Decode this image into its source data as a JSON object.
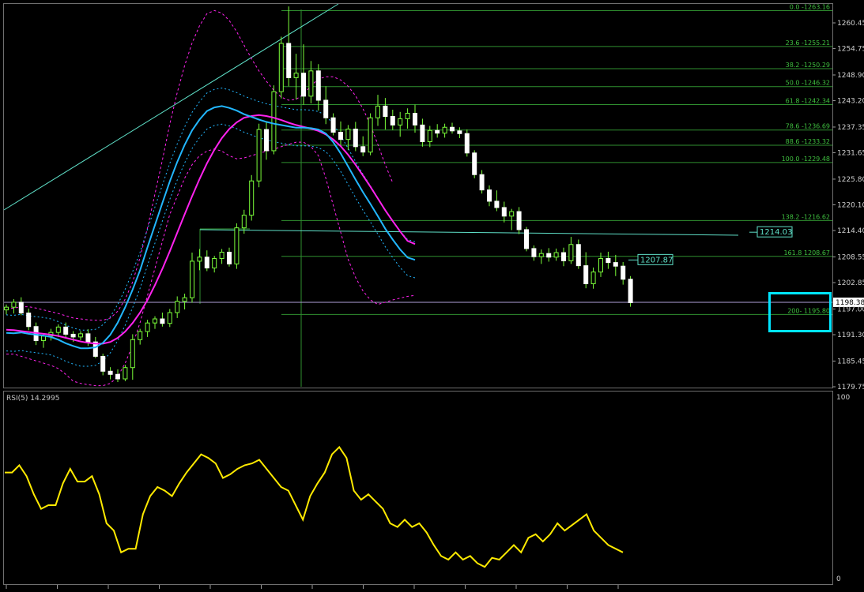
{
  "chart_data": [
    {
      "type": "candlestick",
      "ylim": [
        1179.75,
        1266.2
      ],
      "y_ticks": [
        "1260.45",
        "1254.75",
        "1248.90",
        "1243.20",
        "1237.35",
        "1231.65",
        "1225.80",
        "1220.10",
        "1214.40",
        "1208.55",
        "1202.85",
        "1197.00",
        "1191.30",
        "1185.45",
        "1179.75"
      ],
      "current_price": "1198.38",
      "fibonacci_levels": [
        {
          "label": "0.0 -1263.16",
          "value": 1263.16
        },
        {
          "label": "23.6 -1255.21",
          "value": 1255.21
        },
        {
          "label": "38.2 -1250.29",
          "value": 1250.29
        },
        {
          "label": "50.0 -1246.32",
          "value": 1246.32
        },
        {
          "label": "61.8 -1242.34",
          "value": 1242.34
        },
        {
          "label": "78.6 -1236.69",
          "value": 1236.69
        },
        {
          "label": "88.6 -1233.32",
          "value": 1233.32
        },
        {
          "label": "100.0 -1229.48",
          "value": 1229.48
        },
        {
          "label": "138.2 -1216.62",
          "value": 1216.62
        },
        {
          "label": "161.8 1208.67",
          "value": 1208.67
        },
        {
          "label": "200- 1195.80",
          "value": 1195.8
        }
      ],
      "price_tags": [
        {
          "label": "1214.03",
          "value": 1214.03
        },
        {
          "label": "1207.87",
          "value": 1207.87
        }
      ],
      "series": [
        {
          "type": "line",
          "color": "#22b7ff",
          "values": [
            1191.7,
            1191.6,
            1191.8,
            1191.5,
            1191.3,
            1191.1,
            1190.8,
            1190.2,
            1189.4,
            1188.8,
            1188.3,
            1188.3,
            1188.5,
            1189.5,
            1191.3,
            1194.0,
            1197.4,
            1201.3,
            1205.6,
            1210.7,
            1215.6,
            1220.5,
            1225.3,
            1229.6,
            1233.4,
            1236.6,
            1239.0,
            1240.9,
            1241.7,
            1242.0,
            1241.6,
            1241.0,
            1240.2,
            1239.6,
            1239.0,
            1238.5,
            1238.1,
            1237.8,
            1237.5,
            1237.2,
            1237.2,
            1237.1,
            1236.8,
            1235.9,
            1234.0,
            1231.5,
            1228.6,
            1225.7,
            1222.9,
            1220.3,
            1217.6,
            1214.8,
            1212.4,
            1210.2,
            1208.4,
            1207.9
          ]
        },
        {
          "type": "line",
          "color": "#ff22ee",
          "values": [
            1192.4,
            1192.3,
            1192.1,
            1191.9,
            1191.7,
            1191.5,
            1191.3,
            1191.0,
            1190.6,
            1190.2,
            1189.8,
            1189.5,
            1189.3,
            1189.3,
            1189.7,
            1190.6,
            1192.0,
            1193.9,
            1196.2,
            1199.0,
            1202.3,
            1205.9,
            1209.8,
            1213.9,
            1218.0,
            1222.0,
            1225.8,
            1229.3,
            1232.3,
            1234.9,
            1236.9,
            1238.4,
            1239.4,
            1239.8,
            1240.0,
            1239.8,
            1239.4,
            1238.9,
            1238.3,
            1237.8,
            1237.4,
            1237.0,
            1236.5,
            1235.7,
            1234.6,
            1233.1,
            1231.2,
            1229.0,
            1226.6,
            1224.1,
            1221.5,
            1218.9,
            1216.5,
            1214.2,
            1212.1,
            1211.4
          ]
        },
        {
          "type": "line",
          "color": "#ff22ee",
          "values": [
            1187,
            1187,
            1186.5,
            1186,
            1185.5,
            1185,
            1184.5,
            1183.8,
            1182.5,
            1181,
            1180.5,
            1180.2,
            1180,
            1180,
            1180.5,
            1182,
            1185,
            1189,
            1194,
            1200,
            1206,
            1212,
            1218,
            1222,
            1226,
            1229,
            1231,
            1232,
            1232.5,
            1232,
            1231,
            1230.3,
            1230.5,
            1231,
            1231.5,
            1232,
            1232.4,
            1233,
            1233.5,
            1234,
            1234,
            1233,
            1231,
            1226,
            1220,
            1214,
            1208,
            1204,
            1201,
            1199,
            1198,
            1198.5,
            1199,
            1199.4,
            1199.8,
            1200
          ]
        },
        {
          "type": "line",
          "color": "#ff22ee",
          "values": [
            1197,
            1197.2,
            1197.5,
            1197.5,
            1197.2,
            1196.8,
            1196.4,
            1196,
            1195.5,
            1195,
            1194.8,
            1194.6,
            1194.5,
            1194.5,
            1195,
            1196.5,
            1199.2,
            1203,
            1208.4,
            1215,
            1222.5,
            1230,
            1238,
            1245,
            1251,
            1256,
            1259.8,
            1262.5,
            1263.2,
            1262.6,
            1261,
            1258.5,
            1255.5,
            1252.5,
            1249.8,
            1247.5,
            1245.5,
            1244,
            1243.3,
            1243.5,
            1244.6,
            1246.5,
            1248,
            1248.5,
            1248.5,
            1247.8,
            1246.4,
            1244.3,
            1241.4,
            1237.8,
            1233.5,
            1229,
            1225
          ]
        }
      ],
      "candles": [
        {
          "o": 1196.8,
          "h": 1198.0,
          "l": 1195.8,
          "c": 1197.4
        },
        {
          "o": 1197.4,
          "h": 1199.2,
          "l": 1196.0,
          "c": 1198.5
        },
        {
          "o": 1198.5,
          "h": 1199.6,
          "l": 1195.6,
          "c": 1196.1
        },
        {
          "o": 1196.1,
          "h": 1197.1,
          "l": 1192.3,
          "c": 1193.1
        },
        {
          "o": 1193.1,
          "h": 1194.0,
          "l": 1189.0,
          "c": 1190.0
        },
        {
          "o": 1190.0,
          "h": 1191.6,
          "l": 1188.4,
          "c": 1191.0
        },
        {
          "o": 1191.0,
          "h": 1192.6,
          "l": 1190.0,
          "c": 1191.8
        },
        {
          "o": 1191.8,
          "h": 1193.6,
          "l": 1190.8,
          "c": 1193.0
        },
        {
          "o": 1193.0,
          "h": 1194.0,
          "l": 1190.6,
          "c": 1191.4
        },
        {
          "o": 1191.4,
          "h": 1192.1,
          "l": 1189.7,
          "c": 1190.8
        },
        {
          "o": 1190.8,
          "h": 1192.1,
          "l": 1190.1,
          "c": 1191.5
        },
        {
          "o": 1191.5,
          "h": 1192.5,
          "l": 1188.8,
          "c": 1189.7
        },
        {
          "o": 1189.7,
          "h": 1190.8,
          "l": 1186.1,
          "c": 1186.5
        },
        {
          "o": 1186.5,
          "h": 1187.1,
          "l": 1182.3,
          "c": 1183.2
        },
        {
          "o": 1183.2,
          "h": 1184.1,
          "l": 1181.4,
          "c": 1182.5
        },
        {
          "o": 1182.5,
          "h": 1183.6,
          "l": 1180.8,
          "c": 1181.5
        },
        {
          "o": 1181.5,
          "h": 1184.6,
          "l": 1181.0,
          "c": 1184.0
        },
        {
          "o": 1184.0,
          "h": 1191.4,
          "l": 1181.3,
          "c": 1190.2
        },
        {
          "o": 1190.2,
          "h": 1192.6,
          "l": 1189.1,
          "c": 1192.0
        },
        {
          "o": 1192.0,
          "h": 1194.6,
          "l": 1190.8,
          "c": 1193.9
        },
        {
          "o": 1193.9,
          "h": 1195.4,
          "l": 1192.6,
          "c": 1194.8
        },
        {
          "o": 1194.8,
          "h": 1196.2,
          "l": 1193.1,
          "c": 1193.8
        },
        {
          "o": 1193.8,
          "h": 1197.0,
          "l": 1193.0,
          "c": 1196.2
        },
        {
          "o": 1196.2,
          "h": 1199.8,
          "l": 1195.0,
          "c": 1198.7
        },
        {
          "o": 1198.7,
          "h": 1200.4,
          "l": 1196.9,
          "c": 1199.5
        },
        {
          "o": 1199.5,
          "h": 1209.5,
          "l": 1198.4,
          "c": 1207.6
        },
        {
          "o": 1207.6,
          "h": 1210.3,
          "l": 1205.6,
          "c": 1208.5
        },
        {
          "o": 1208.5,
          "h": 1210.0,
          "l": 1205.4,
          "c": 1206.1
        },
        {
          "o": 1206.1,
          "h": 1208.8,
          "l": 1205.1,
          "c": 1208.2
        },
        {
          "o": 1208.2,
          "h": 1210.3,
          "l": 1207.0,
          "c": 1209.6
        },
        {
          "o": 1209.6,
          "h": 1210.6,
          "l": 1206.4,
          "c": 1207.0
        },
        {
          "o": 1207.0,
          "h": 1216.0,
          "l": 1205.9,
          "c": 1215.0
        },
        {
          "o": 1215.0,
          "h": 1219.0,
          "l": 1213.7,
          "c": 1217.8
        },
        {
          "o": 1217.8,
          "h": 1226.7,
          "l": 1216.6,
          "c": 1225.4
        },
        {
          "o": 1225.4,
          "h": 1238.1,
          "l": 1224.0,
          "c": 1236.8
        },
        {
          "o": 1236.8,
          "h": 1238.4,
          "l": 1230.1,
          "c": 1232.1
        },
        {
          "o": 1232.1,
          "h": 1246.6,
          "l": 1231.3,
          "c": 1245.2
        },
        {
          "o": 1245.2,
          "h": 1257.4,
          "l": 1243.7,
          "c": 1255.9
        },
        {
          "o": 1255.9,
          "h": 1264.1,
          "l": 1246.4,
          "c": 1248.3
        },
        {
          "o": 1248.3,
          "h": 1253.6,
          "l": 1243.5,
          "c": 1249.3
        },
        {
          "o": 1249.3,
          "h": 1255.7,
          "l": 1242.3,
          "c": 1244.2
        },
        {
          "o": 1244.2,
          "h": 1252.0,
          "l": 1242.6,
          "c": 1249.8
        },
        {
          "o": 1249.8,
          "h": 1251.3,
          "l": 1241.0,
          "c": 1243.3
        },
        {
          "o": 1243.3,
          "h": 1246.4,
          "l": 1238.0,
          "c": 1239.4
        },
        {
          "o": 1239.4,
          "h": 1240.4,
          "l": 1235.5,
          "c": 1236.2
        },
        {
          "o": 1236.2,
          "h": 1238.6,
          "l": 1233.4,
          "c": 1234.6
        },
        {
          "o": 1234.6,
          "h": 1237.8,
          "l": 1232.3,
          "c": 1236.9
        },
        {
          "o": 1236.9,
          "h": 1238.5,
          "l": 1232.0,
          "c": 1233.0
        },
        {
          "o": 1233.0,
          "h": 1235.3,
          "l": 1230.9,
          "c": 1231.8
        },
        {
          "o": 1231.8,
          "h": 1240.4,
          "l": 1231.1,
          "c": 1239.4
        },
        {
          "o": 1239.4,
          "h": 1244.5,
          "l": 1237.6,
          "c": 1242.0
        },
        {
          "o": 1242.0,
          "h": 1243.8,
          "l": 1236.8,
          "c": 1239.7
        },
        {
          "o": 1239.7,
          "h": 1241.2,
          "l": 1236.7,
          "c": 1237.8
        },
        {
          "o": 1237.8,
          "h": 1240.7,
          "l": 1235.2,
          "c": 1239.2
        },
        {
          "o": 1239.2,
          "h": 1241.5,
          "l": 1237.0,
          "c": 1240.4
        },
        {
          "o": 1240.4,
          "h": 1242.3,
          "l": 1236.1,
          "c": 1237.8
        },
        {
          "o": 1237.8,
          "h": 1239.2,
          "l": 1233.0,
          "c": 1234.1
        },
        {
          "o": 1234.1,
          "h": 1237.6,
          "l": 1232.9,
          "c": 1236.6
        },
        {
          "o": 1236.6,
          "h": 1238.0,
          "l": 1235.0,
          "c": 1236.0
        },
        {
          "o": 1236.0,
          "h": 1238.1,
          "l": 1235.0,
          "c": 1237.3
        },
        {
          "o": 1237.3,
          "h": 1238.3,
          "l": 1235.9,
          "c": 1236.5
        },
        {
          "o": 1236.5,
          "h": 1237.3,
          "l": 1234.9,
          "c": 1235.9
        },
        {
          "o": 1235.9,
          "h": 1236.8,
          "l": 1230.8,
          "c": 1231.6
        },
        {
          "o": 1231.6,
          "h": 1232.2,
          "l": 1226.0,
          "c": 1226.8
        },
        {
          "o": 1226.8,
          "h": 1227.8,
          "l": 1222.6,
          "c": 1223.4
        },
        {
          "o": 1223.4,
          "h": 1224.4,
          "l": 1219.8,
          "c": 1220.9
        },
        {
          "o": 1220.9,
          "h": 1223.3,
          "l": 1218.7,
          "c": 1219.5
        },
        {
          "o": 1219.5,
          "h": 1220.8,
          "l": 1216.2,
          "c": 1217.6
        },
        {
          "o": 1217.6,
          "h": 1219.2,
          "l": 1214.5,
          "c": 1218.6
        },
        {
          "o": 1218.6,
          "h": 1219.6,
          "l": 1213.6,
          "c": 1214.6
        },
        {
          "o": 1214.6,
          "h": 1215.2,
          "l": 1209.8,
          "c": 1210.4
        },
        {
          "o": 1210.4,
          "h": 1211.1,
          "l": 1207.7,
          "c": 1208.6
        },
        {
          "o": 1208.6,
          "h": 1210.2,
          "l": 1207.0,
          "c": 1209.3
        },
        {
          "o": 1209.3,
          "h": 1210.5,
          "l": 1207.5,
          "c": 1208.5
        },
        {
          "o": 1208.5,
          "h": 1210.4,
          "l": 1207.7,
          "c": 1209.5
        },
        {
          "o": 1209.5,
          "h": 1210.6,
          "l": 1206.5,
          "c": 1207.7
        },
        {
          "o": 1207.7,
          "h": 1213.0,
          "l": 1207.0,
          "c": 1211.3
        },
        {
          "o": 1211.3,
          "h": 1212.4,
          "l": 1205.9,
          "c": 1206.6
        },
        {
          "o": 1206.6,
          "h": 1209.6,
          "l": 1201.6,
          "c": 1202.6
        },
        {
          "o": 1202.6,
          "h": 1206.2,
          "l": 1201.5,
          "c": 1205.2
        },
        {
          "o": 1205.2,
          "h": 1209.5,
          "l": 1204.1,
          "c": 1208.2
        },
        {
          "o": 1208.2,
          "h": 1209.7,
          "l": 1205.9,
          "c": 1207.3
        },
        {
          "o": 1207.3,
          "h": 1209.0,
          "l": 1204.3,
          "c": 1206.5
        },
        {
          "o": 1206.5,
          "h": 1207.4,
          "l": 1202.4,
          "c": 1203.6
        },
        {
          "o": 1203.6,
          "h": 1204.3,
          "l": 1197.5,
          "c": 1198.4
        }
      ]
    },
    {
      "type": "line",
      "title": "RSI(5) 14.2995",
      "ylim": [
        0,
        100
      ],
      "y_ticks": [
        "100",
        "0"
      ],
      "series": [
        {
          "name": "RSI(5)",
          "color": "#ffea00",
          "values": [
            58,
            58,
            62,
            56,
            46,
            38,
            40,
            40,
            52,
            60,
            53,
            53,
            56,
            46,
            30,
            26,
            14,
            16,
            16,
            35,
            45,
            50,
            48,
            45,
            52,
            58,
            63,
            68,
            66,
            63,
            55,
            57,
            60,
            62,
            63,
            65,
            60,
            55,
            50,
            48,
            40,
            32,
            45,
            52,
            58,
            68,
            72,
            66,
            48,
            43,
            46,
            42,
            38,
            30,
            28,
            32,
            28,
            30,
            25,
            18,
            12,
            10,
            14,
            10,
            12,
            8,
            6,
            11,
            10,
            14,
            18,
            14,
            22,
            24,
            20,
            24,
            30,
            26,
            29,
            32,
            35,
            26,
            22,
            18,
            16,
            14
          ]
        }
      ]
    }
  ]
}
